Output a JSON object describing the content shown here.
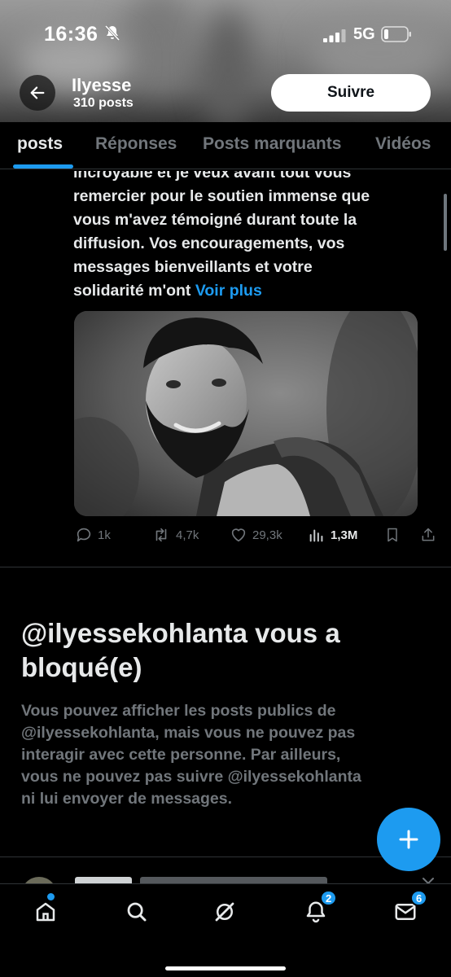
{
  "status_bar": {
    "time": "16:36",
    "network": "5G"
  },
  "header": {
    "name": "Ilyesse",
    "post_count": "310 posts",
    "follow_label": "Suivre"
  },
  "tabs": [
    {
      "label": "posts"
    },
    {
      "label": "Réponses"
    },
    {
      "label": "Posts marquants"
    },
    {
      "label": "Vidéos"
    }
  ],
  "post": {
    "lines": [
      "incroyable et je veux avant tout vous",
      "remercier pour le soutien immense que",
      "vous m'avez témoigné durant toute la",
      "diffusion. Vos encouragements, vos",
      "messages bienveillants et votre"
    ],
    "last_line": "solidarité m'ont",
    "see_more": "Voir plus",
    "stats": {
      "replies": "1k",
      "reposts": "4,7k",
      "likes": "29,3k",
      "views": "1,3M"
    }
  },
  "blocked": {
    "title_lines": [
      "@ilyessekohlanta vous a",
      "bloqué(e)"
    ],
    "description_lines": [
      "Vous pouvez afficher les posts publics de",
      "@ilyessekohlanta, mais vous ne pouvez pas",
      "interagir avec cette personne. Par ailleurs,",
      "vous ne pouvez pas suivre @ilyessekohlanta",
      "ni lui envoyer de messages."
    ]
  },
  "bottom_nav": {
    "notifications_badge": "2",
    "messages_badge": "6"
  },
  "colors": {
    "accent": "#1d9bf0",
    "background": "#000000",
    "muted_text": "#71767b",
    "primary_text": "#e7e9ea"
  }
}
